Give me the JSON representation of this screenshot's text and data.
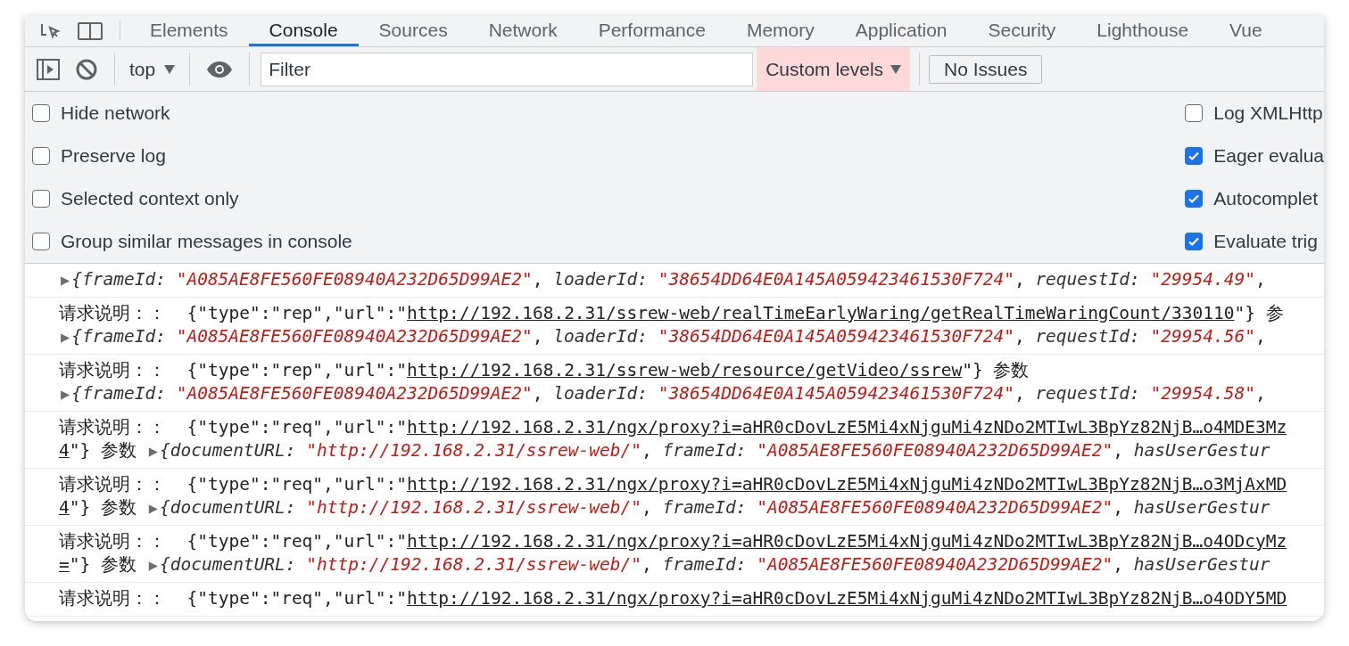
{
  "tabs": [
    {
      "label": "Elements",
      "selected": false
    },
    {
      "label": "Console",
      "selected": true
    },
    {
      "label": "Sources",
      "selected": false
    },
    {
      "label": "Network",
      "selected": false
    },
    {
      "label": "Performance",
      "selected": false
    },
    {
      "label": "Memory",
      "selected": false
    },
    {
      "label": "Application",
      "selected": false
    },
    {
      "label": "Security",
      "selected": false
    },
    {
      "label": "Lighthouse",
      "selected": false
    },
    {
      "label": "Vue",
      "selected": false
    }
  ],
  "toolbar": {
    "context": "top",
    "filter": {
      "placeholder": "Filter"
    },
    "levels": {
      "label": "Custom levels",
      "highlighted": true
    },
    "issues": "No Issues"
  },
  "settings": {
    "left": [
      {
        "label": "Hide network",
        "checked": false
      },
      {
        "label": "Preserve log",
        "checked": false
      },
      {
        "label": "Selected context only",
        "checked": false
      },
      {
        "label": "Group similar messages in console",
        "checked": false
      }
    ],
    "right": [
      {
        "label": "Log XMLHttp",
        "checked": false
      },
      {
        "label": "Eager evalua",
        "checked": true
      },
      {
        "label": "Autocomplet",
        "checked": true
      },
      {
        "label": "Evaluate trig",
        "checked": true
      }
    ]
  },
  "log": [
    {
      "lines": [
        [
          {
            "kind": "toggle",
            "text": "▶"
          },
          {
            "kind": "key",
            "text": "{frameId:"
          },
          {
            "kind": "string",
            "text": " \"A085AE8FE560FE08940A232D65D99AE2\""
          },
          {
            "kind": "text",
            "text": ", "
          },
          {
            "kind": "key",
            "text": "loaderId:"
          },
          {
            "kind": "string",
            "text": " \"38654DD64E0A145A059423461530F724\""
          },
          {
            "kind": "text",
            "text": ", "
          },
          {
            "kind": "key",
            "text": "requestId:"
          },
          {
            "kind": "string",
            "text": " \"29954.49\""
          },
          {
            "kind": "text",
            "text": ","
          }
        ]
      ]
    },
    {
      "lines": [
        [
          {
            "kind": "text",
            "text": "请求说明：：  {\"type\":\"rep\",\"url\":\""
          },
          {
            "kind": "link",
            "text": "http://192.168.2.31/ssrew-web/realTimeEarlyWaring/getRealTimeWaringCount/330110"
          },
          {
            "kind": "text",
            "text": "\"} 参"
          }
        ],
        [
          {
            "kind": "toggle",
            "text": "▶"
          },
          {
            "kind": "key",
            "text": "{frameId:"
          },
          {
            "kind": "string",
            "text": " \"A085AE8FE560FE08940A232D65D99AE2\""
          },
          {
            "kind": "text",
            "text": ", "
          },
          {
            "kind": "key",
            "text": "loaderId:"
          },
          {
            "kind": "string",
            "text": " \"38654DD64E0A145A059423461530F724\""
          },
          {
            "kind": "text",
            "text": ", "
          },
          {
            "kind": "key",
            "text": "requestId:"
          },
          {
            "kind": "string",
            "text": " \"29954.56\""
          },
          {
            "kind": "text",
            "text": ","
          }
        ]
      ]
    },
    {
      "lines": [
        [
          {
            "kind": "text",
            "text": "请求说明：：  {\"type\":\"rep\",\"url\":\""
          },
          {
            "kind": "link",
            "text": "http://192.168.2.31/ssrew-web/resource/getVideo/ssrew"
          },
          {
            "kind": "text",
            "text": "\"} 参数"
          }
        ],
        [
          {
            "kind": "toggle",
            "text": "▶"
          },
          {
            "kind": "key",
            "text": "{frameId:"
          },
          {
            "kind": "string",
            "text": " \"A085AE8FE560FE08940A232D65D99AE2\""
          },
          {
            "kind": "text",
            "text": ", "
          },
          {
            "kind": "key",
            "text": "loaderId:"
          },
          {
            "kind": "string",
            "text": " \"38654DD64E0A145A059423461530F724\""
          },
          {
            "kind": "text",
            "text": ", "
          },
          {
            "kind": "key",
            "text": "requestId:"
          },
          {
            "kind": "string",
            "text": " \"29954.58\""
          },
          {
            "kind": "text",
            "text": ","
          }
        ]
      ]
    },
    {
      "lines": [
        [
          {
            "kind": "text",
            "text": "请求说明：：  {\"type\":\"req\",\"url\":\""
          },
          {
            "kind": "link",
            "text": "http://192.168.2.31/ngx/proxy?i=aHR0cDovLzE5Mi4xNjguMi4zNDo2MTIwL3BpYz82NjB…o4MDE3Mz"
          }
        ],
        [
          {
            "kind": "link",
            "text": "4"
          },
          {
            "kind": "text",
            "text": "\"} 参数 "
          },
          {
            "kind": "toggle",
            "text": "▶"
          },
          {
            "kind": "key",
            "text": "{documentURL:"
          },
          {
            "kind": "string",
            "text": " \"http://192.168.2.31/ssrew-web/\""
          },
          {
            "kind": "text",
            "text": ", "
          },
          {
            "kind": "key",
            "text": "frameId:"
          },
          {
            "kind": "string",
            "text": " \"A085AE8FE560FE08940A232D65D99AE2\""
          },
          {
            "kind": "text",
            "text": ", "
          },
          {
            "kind": "key",
            "text": "hasUserGestur"
          }
        ]
      ]
    },
    {
      "lines": [
        [
          {
            "kind": "text",
            "text": "请求说明：：  {\"type\":\"req\",\"url\":\""
          },
          {
            "kind": "link",
            "text": "http://192.168.2.31/ngx/proxy?i=aHR0cDovLzE5Mi4xNjguMi4zNDo2MTIwL3BpYz82NjB…o3MjAxMD"
          }
        ],
        [
          {
            "kind": "link",
            "text": "4"
          },
          {
            "kind": "text",
            "text": "\"} 参数 "
          },
          {
            "kind": "toggle",
            "text": "▶"
          },
          {
            "kind": "key",
            "text": "{documentURL:"
          },
          {
            "kind": "string",
            "text": " \"http://192.168.2.31/ssrew-web/\""
          },
          {
            "kind": "text",
            "text": ", "
          },
          {
            "kind": "key",
            "text": "frameId:"
          },
          {
            "kind": "string",
            "text": " \"A085AE8FE560FE08940A232D65D99AE2\""
          },
          {
            "kind": "text",
            "text": ", "
          },
          {
            "kind": "key",
            "text": "hasUserGestur"
          }
        ]
      ]
    },
    {
      "lines": [
        [
          {
            "kind": "text",
            "text": "请求说明：：  {\"type\":\"req\",\"url\":\""
          },
          {
            "kind": "link",
            "text": "http://192.168.2.31/ngx/proxy?i=aHR0cDovLzE5Mi4xNjguMi4zNDo2MTIwL3BpYz82NjB…o4ODcyMz"
          }
        ],
        [
          {
            "kind": "link",
            "text": "="
          },
          {
            "kind": "text",
            "text": "\"} 参数 "
          },
          {
            "kind": "toggle",
            "text": "▶"
          },
          {
            "kind": "key",
            "text": "{documentURL:"
          },
          {
            "kind": "string",
            "text": " \"http://192.168.2.31/ssrew-web/\""
          },
          {
            "kind": "text",
            "text": ", "
          },
          {
            "kind": "key",
            "text": "frameId:"
          },
          {
            "kind": "string",
            "text": " \"A085AE8FE560FE08940A232D65D99AE2\""
          },
          {
            "kind": "text",
            "text": ", "
          },
          {
            "kind": "key",
            "text": "hasUserGestur"
          }
        ]
      ]
    },
    {
      "lines": [
        [
          {
            "kind": "text",
            "text": "请求说明：：  {\"type\":\"req\",\"url\":\""
          },
          {
            "kind": "link",
            "text": "http://192.168.2.31/ngx/proxy?i=aHR0cDovLzE5Mi4xNjguMi4zNDo2MTIwL3BpYz82NjB…o4ODY5MD"
          }
        ]
      ]
    }
  ]
}
